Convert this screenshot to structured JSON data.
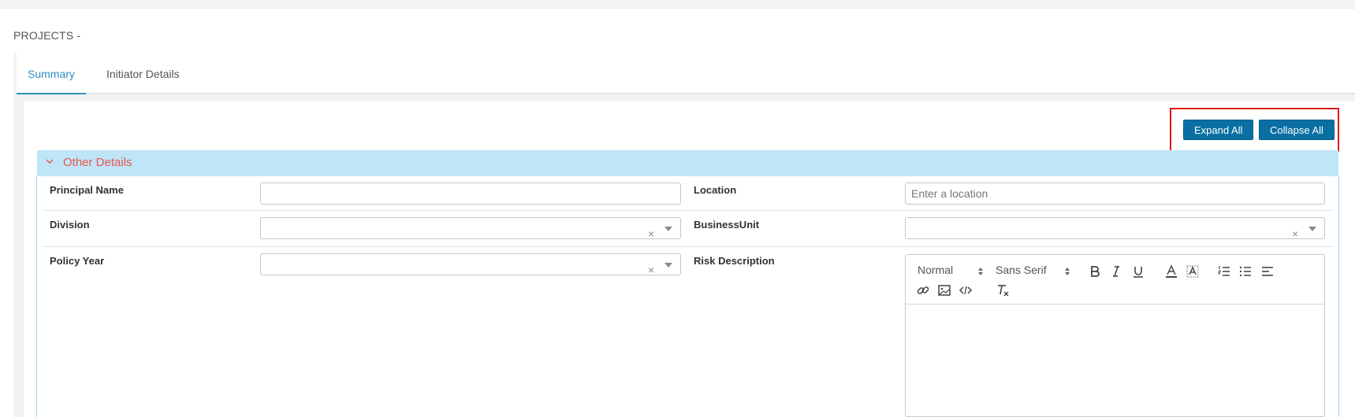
{
  "page": {
    "title": "PROJECTS -"
  },
  "tabs": [
    {
      "label": "Summary",
      "active": true
    },
    {
      "label": "Initiator Details",
      "active": false
    }
  ],
  "actions": {
    "expand_label": "Expand All",
    "collapse_label": "Collapse All"
  },
  "section": {
    "title": "Other Details",
    "fields": {
      "principal_name": {
        "label": "Principal Name",
        "value": ""
      },
      "location": {
        "label": "Location",
        "value": "",
        "placeholder": "Enter a location"
      },
      "division": {
        "label": "Division",
        "value": ""
      },
      "business_unit": {
        "label": "BusinessUnit",
        "value": ""
      },
      "policy_year": {
        "label": "Policy Year",
        "value": ""
      },
      "risk_description": {
        "label": "Risk Description",
        "value": ""
      }
    }
  },
  "editor": {
    "format": "Normal",
    "font": "Sans Serif",
    "clear_glyph": "×"
  },
  "colors": {
    "accent": "#2f8fbf",
    "button": "#0a6fa3",
    "section_header_bg": "#bfe5f8",
    "section_title": "#e8564c",
    "highlight_border": "#e01919"
  },
  "icons": [
    "chevron-down-icon",
    "clear-icon",
    "dropdown-caret-icon",
    "bold-icon",
    "italic-icon",
    "underline-icon",
    "font-color-icon",
    "background-color-icon",
    "ordered-list-icon",
    "bullet-list-icon",
    "align-icon",
    "link-icon",
    "image-icon",
    "code-icon",
    "clear-format-icon"
  ]
}
